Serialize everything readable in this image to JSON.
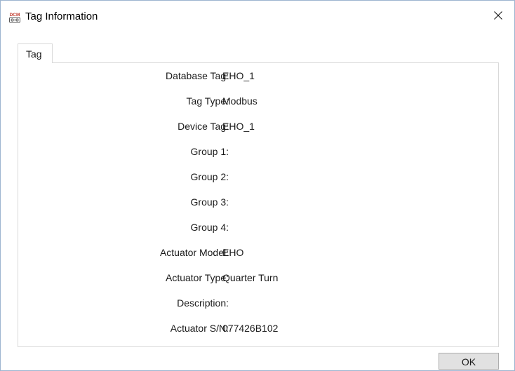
{
  "window": {
    "title": "Tag Information",
    "app_icon": "dcm-app-icon",
    "app_icon_text": "DCM"
  },
  "tabs": [
    {
      "label": "Tag",
      "selected": true
    }
  ],
  "fields": [
    {
      "label": "Database Tag:",
      "value": "EHO_1"
    },
    {
      "label": "Tag Type:",
      "value": "Modbus"
    },
    {
      "label": "Device Tag:",
      "value": "EHO_1"
    },
    {
      "label": "Group 1:",
      "value": ""
    },
    {
      "label": "Group 2:",
      "value": ""
    },
    {
      "label": "Group 3:",
      "value": ""
    },
    {
      "label": "Group 4:",
      "value": ""
    },
    {
      "label": "Actuator Model:",
      "value": "EHO"
    },
    {
      "label": "Actuator Type:",
      "value": "Quarter Turn"
    },
    {
      "label": "Description:",
      "value": ""
    },
    {
      "label": "Actuator S/N:",
      "value": "077426B102"
    }
  ],
  "buttons": {
    "ok_label": "OK"
  },
  "colors": {
    "icon_red": "#c0392b",
    "border": "#d9d9d9",
    "button_bg": "#e1e1e1"
  }
}
